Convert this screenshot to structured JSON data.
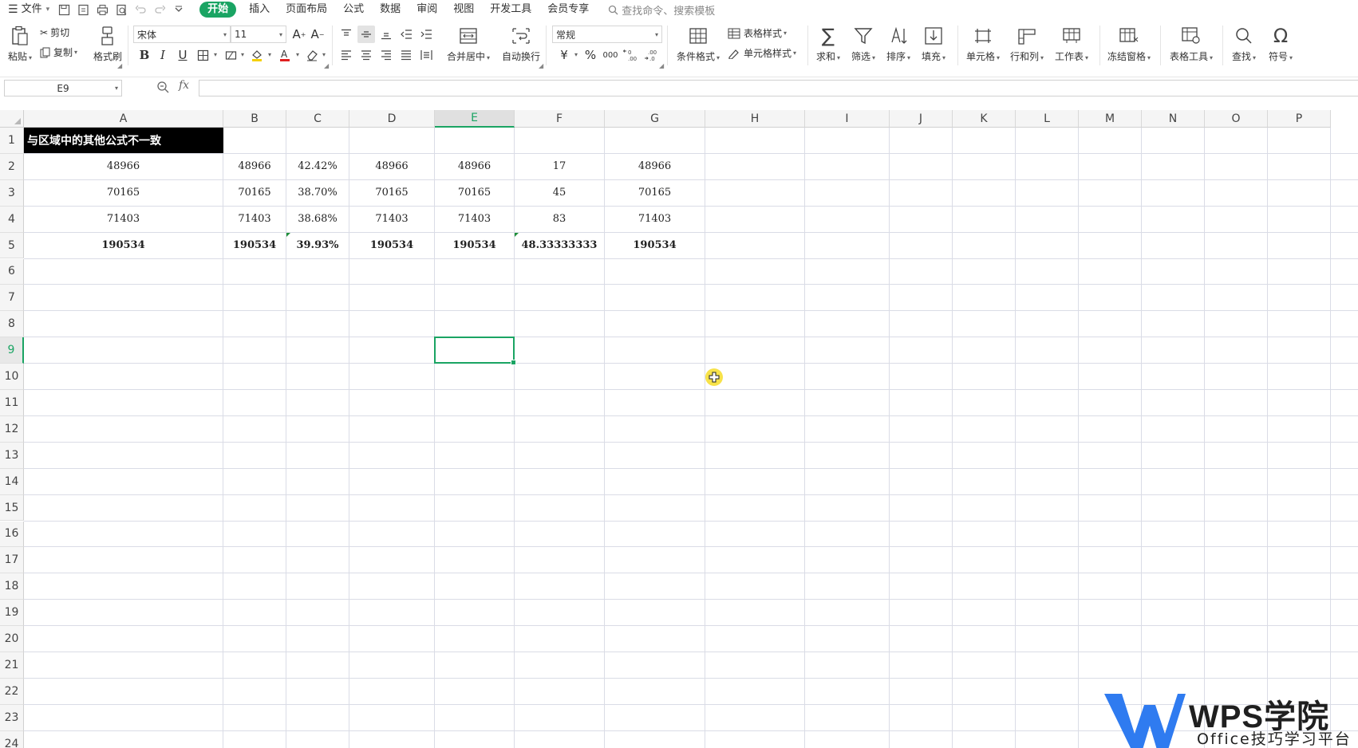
{
  "menu": {
    "file_label": "文件",
    "tabs": [
      {
        "label": "开始",
        "active": true
      },
      {
        "label": "插入"
      },
      {
        "label": "页面布局"
      },
      {
        "label": "公式"
      },
      {
        "label": "数据"
      },
      {
        "label": "审阅"
      },
      {
        "label": "视图"
      },
      {
        "label": "开发工具"
      },
      {
        "label": "会员专享"
      }
    ],
    "search_placeholder": "查找命令、搜索模板"
  },
  "ribbon": {
    "paste": "粘贴",
    "cut": "剪切",
    "copy": "复制",
    "format_painter": "格式刷",
    "font_name": "宋体",
    "font_size": "11",
    "merge_center": "合并居中",
    "wrap_text": "自动换行",
    "number_format": "常规",
    "conditional_format": "条件格式",
    "table_style": "表格样式",
    "cell_style": "单元格样式",
    "sum": "求和",
    "filter": "筛选",
    "sort": "排序",
    "fill": "填充",
    "cell": "单元格",
    "row_col": "行和列",
    "worksheet": "工作表",
    "freeze": "冻结窗格",
    "table_tools": "表格工具",
    "find": "查找",
    "symbol": "符号",
    "currency_symbol": "¥",
    "percent_symbol": "%",
    "thousands_symbol": "000"
  },
  "formula_bar": {
    "name_box": "E9",
    "fx_label": "fx",
    "formula": ""
  },
  "sheet": {
    "columns": [
      "A",
      "B",
      "C",
      "D",
      "E",
      "F",
      "G",
      "H",
      "I",
      "J",
      "K",
      "L",
      "M",
      "N",
      "O",
      "P"
    ],
    "rows": [
      "1",
      "2",
      "3",
      "4",
      "5",
      "6",
      "7",
      "8",
      "9",
      "10",
      "11",
      "12",
      "13",
      "14",
      "15",
      "16",
      "17",
      "18",
      "19",
      "20",
      "21",
      "22",
      "23",
      "24"
    ],
    "selected_cell": "E9",
    "header_text": "与区域中的其他公式不一致",
    "data": [
      [
        "48966",
        "48966",
        "42.42%",
        "48966",
        "48966",
        "17",
        "48966"
      ],
      [
        "70165",
        "70165",
        "38.70%",
        "70165",
        "70165",
        "45",
        "70165"
      ],
      [
        "71403",
        "71403",
        "38.68%",
        "71403",
        "71403",
        "83",
        "71403"
      ],
      [
        "190534",
        "190534",
        "39.93%",
        "190534",
        "190534",
        "48.33333333",
        "190534"
      ]
    ]
  },
  "watermark": {
    "brand": "WPS学院",
    "tagline": "Office技巧学习平台"
  }
}
